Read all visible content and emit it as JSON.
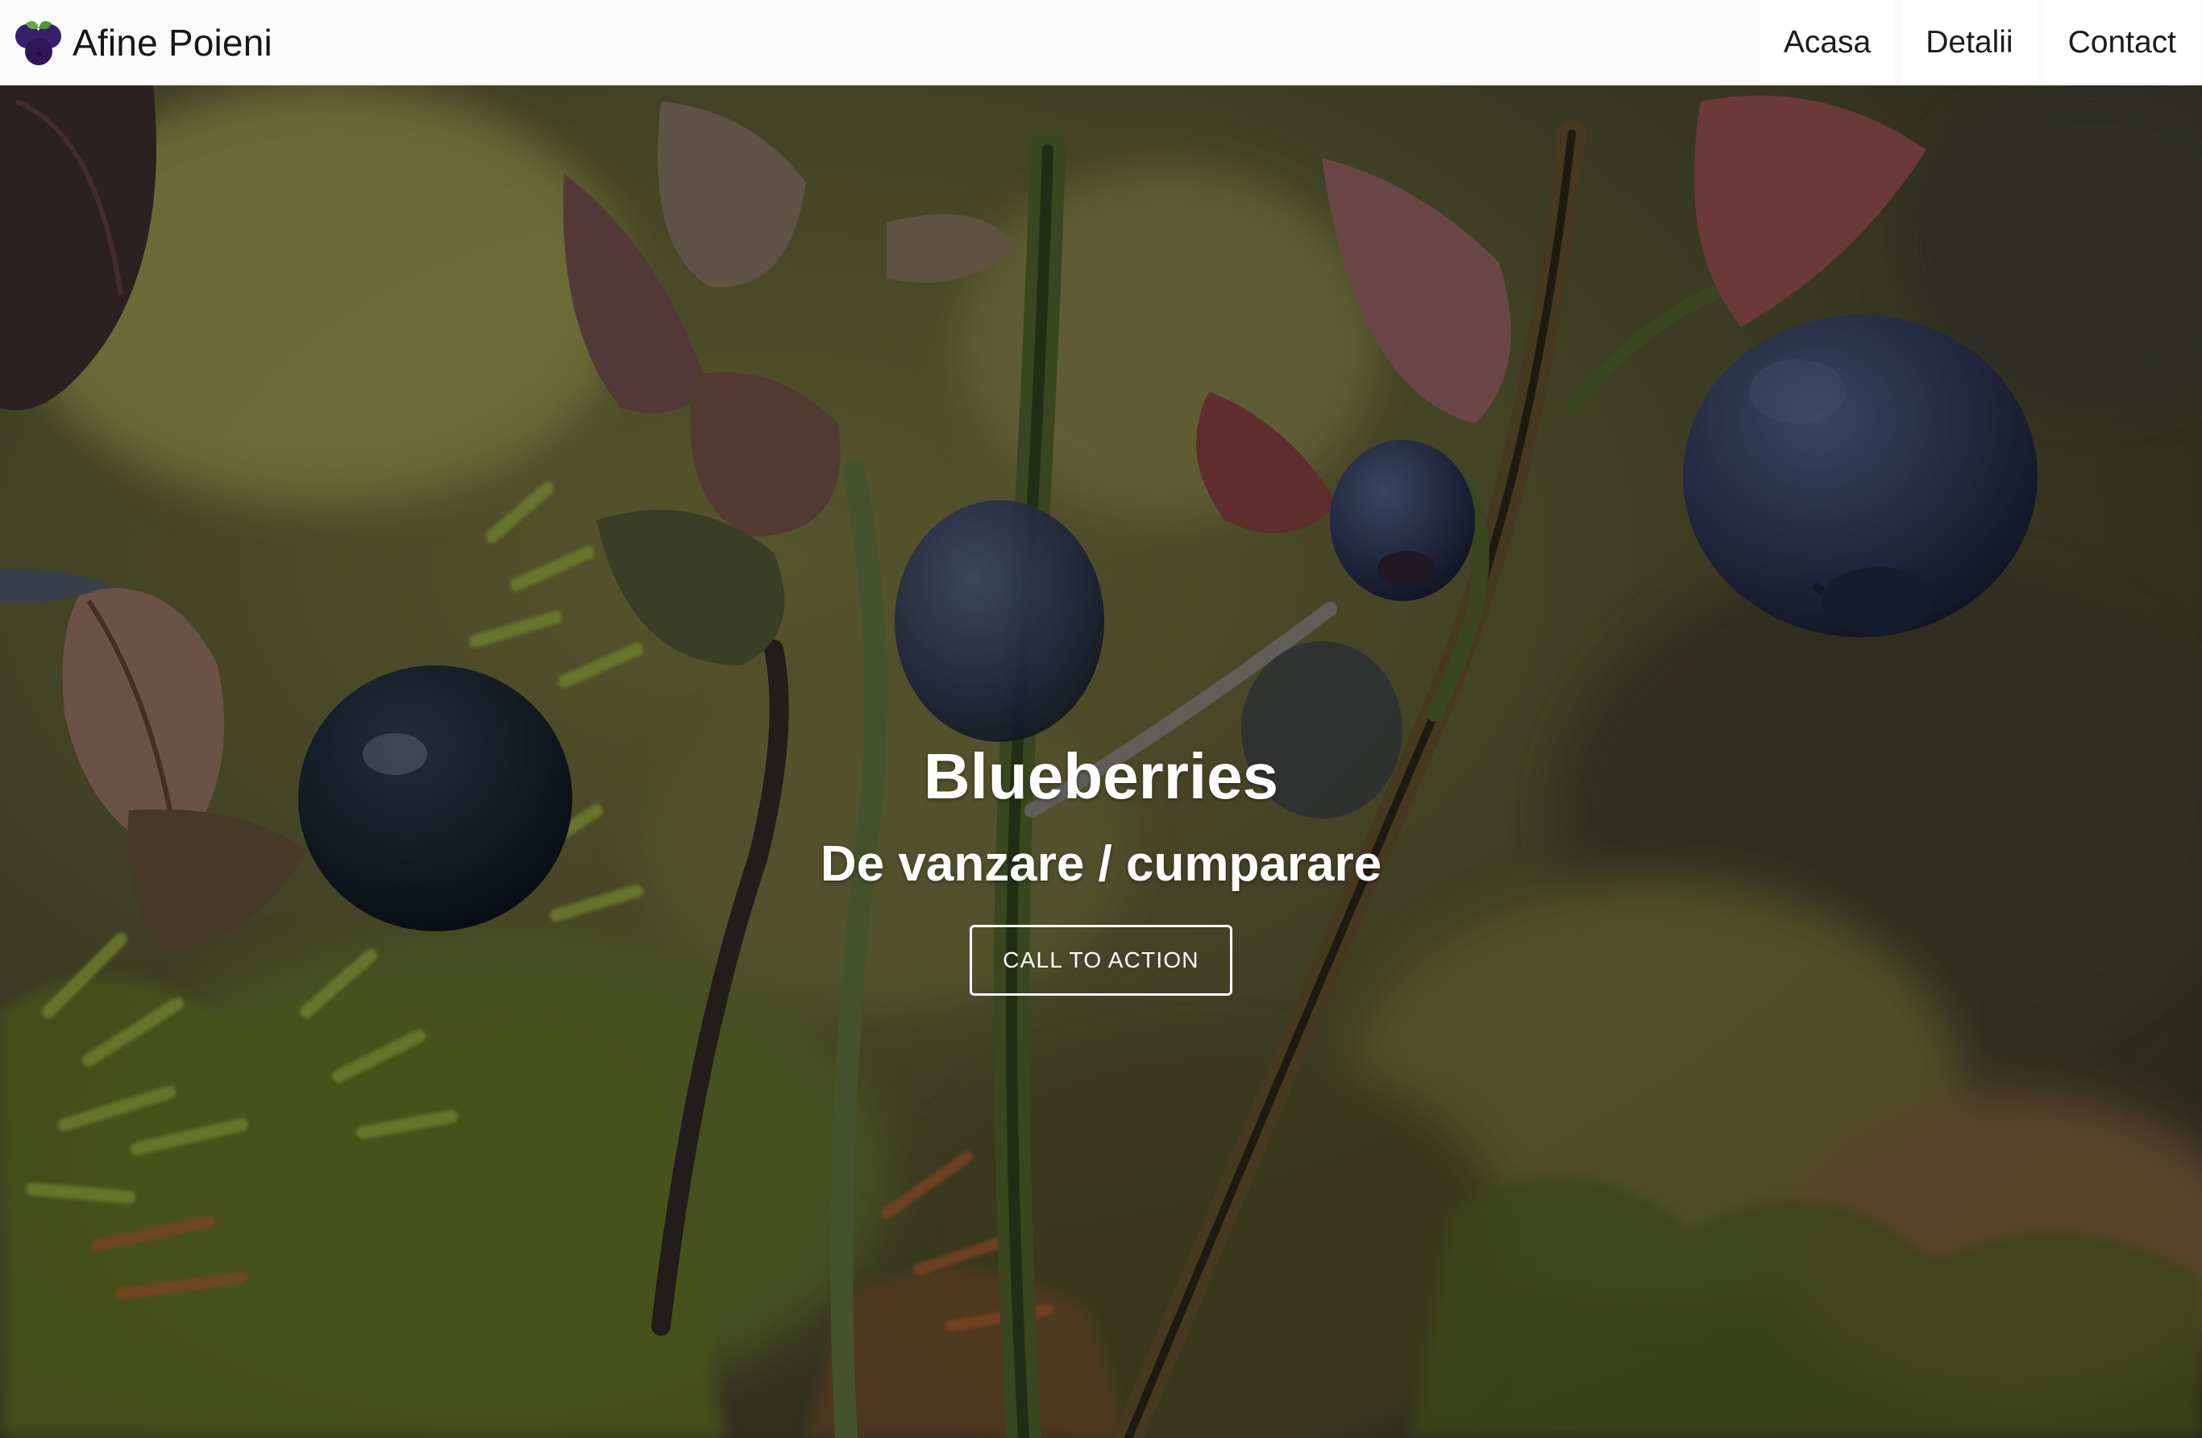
{
  "brand": {
    "name": "Afine Poieni",
    "logo_icon": "blueberry-icon"
  },
  "nav": {
    "items": [
      {
        "label": "Acasa"
      },
      {
        "label": "Detalii"
      },
      {
        "label": "Contact"
      }
    ]
  },
  "hero": {
    "background": "blueberry-bush-photo",
    "title": "Blueberries",
    "subtitle": "De vanzare / cumparare",
    "cta_label": "CALL TO ACTION"
  },
  "colors": {
    "navbar_bg": "#fbfbfb",
    "berry": "#2a3350",
    "leaf": "#7a8a32",
    "text_on_hero": "#ffffff"
  }
}
